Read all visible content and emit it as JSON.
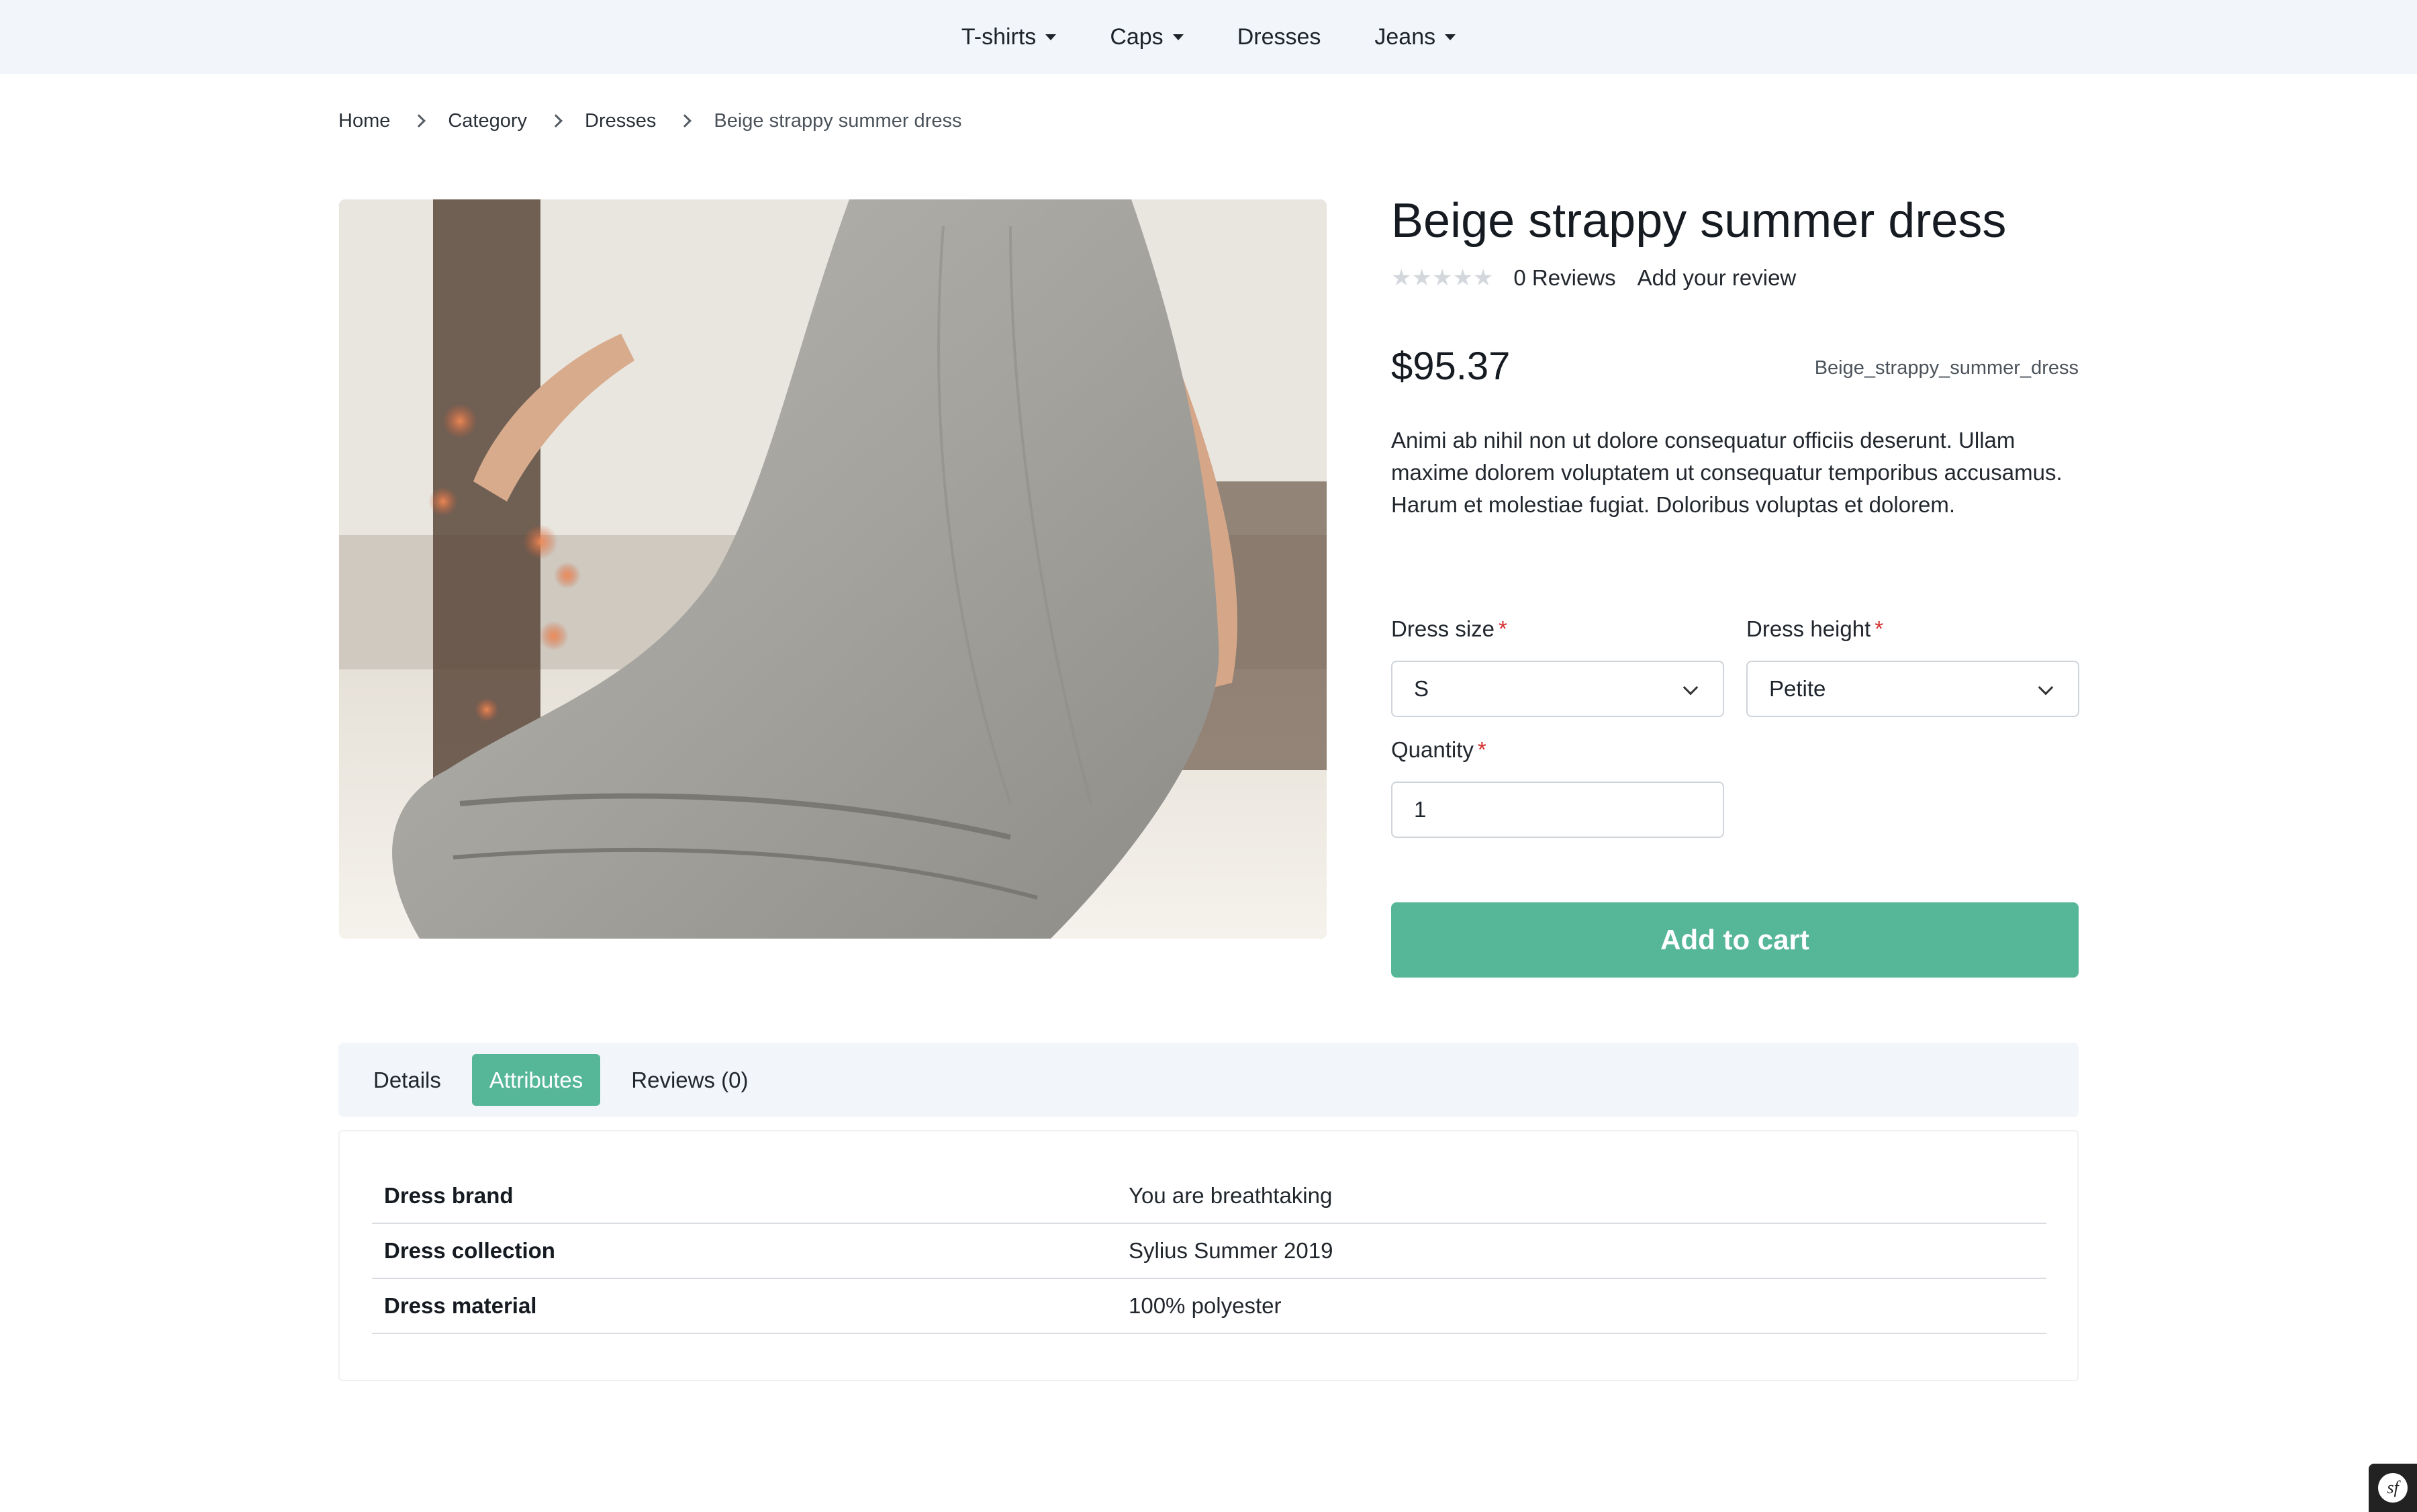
{
  "nav": {
    "items": [
      {
        "label": "T-shirts",
        "dropdown": true
      },
      {
        "label": "Caps",
        "dropdown": true
      },
      {
        "label": "Dresses",
        "dropdown": false
      },
      {
        "label": "Jeans",
        "dropdown": true
      }
    ]
  },
  "breadcrumb": [
    "Home",
    "Category",
    "Dresses",
    "Beige strappy summer dress"
  ],
  "product": {
    "title": "Beige strappy summer dress",
    "rating_stars": "★★★★★",
    "reviews_count": "0 Reviews",
    "add_review": "Add your review",
    "price": "$95.37",
    "sku": "Beige_strappy_summer_dress",
    "description": "Animi ab nihil non ut dolore consequatur officiis deserunt. Ullam maxime dolorem voluptatem ut consequatur temporibus accusamus. Harum et molestiae fugiat. Doloribus voluptas et dolorem."
  },
  "options": {
    "dress_size": {
      "label": "Dress size",
      "required": "*",
      "value": "S"
    },
    "dress_height": {
      "label": "Dress height",
      "required": "*",
      "value": "Petite"
    },
    "quantity": {
      "label": "Quantity",
      "required": "*",
      "value": "1"
    }
  },
  "add_to_cart": "Add to cart",
  "tabs": [
    {
      "label": "Details",
      "active": false
    },
    {
      "label": "Attributes",
      "active": true
    },
    {
      "label": "Reviews (0)",
      "active": false
    }
  ],
  "attributes": [
    {
      "name": "Dress brand",
      "value": "You are breathtaking"
    },
    {
      "name": "Dress collection",
      "value": "Sylius Summer 2019"
    },
    {
      "name": "Dress material",
      "value": "100% polyester"
    }
  ],
  "badge": {
    "glyph": "sf"
  },
  "colors": {
    "accent": "#56b698",
    "nav_bg": "#f2f5f9",
    "star_empty": "#d4d8dd",
    "required": "#d32f2f"
  }
}
